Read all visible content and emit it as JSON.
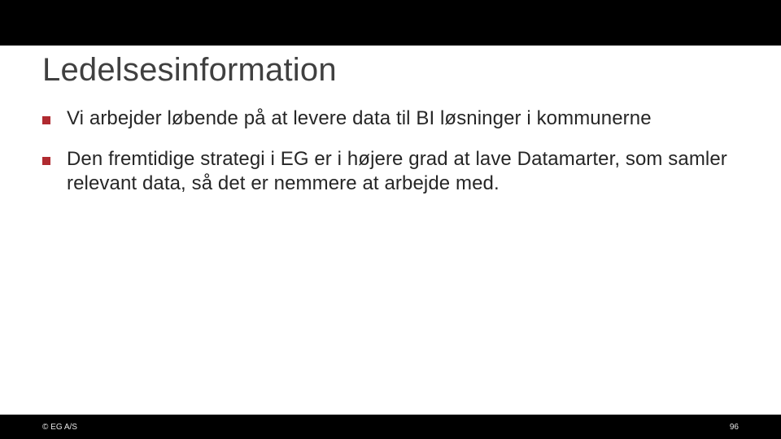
{
  "slide": {
    "title": "Ledelsesinformation",
    "bullets": [
      "Vi arbejder løbende på at levere data til BI løsninger i kommunerne",
      "Den fremtidige strategi i EG er i højere grad at lave Datamarter, som samler relevant data, så det er nemmere at arbejde med."
    ]
  },
  "footer": {
    "copyright": "© EG A/S",
    "page_number": "96"
  },
  "colors": {
    "bullet_square": "#b02a30",
    "footer_bg": "#000000",
    "slide_bg": "#ffffff"
  }
}
